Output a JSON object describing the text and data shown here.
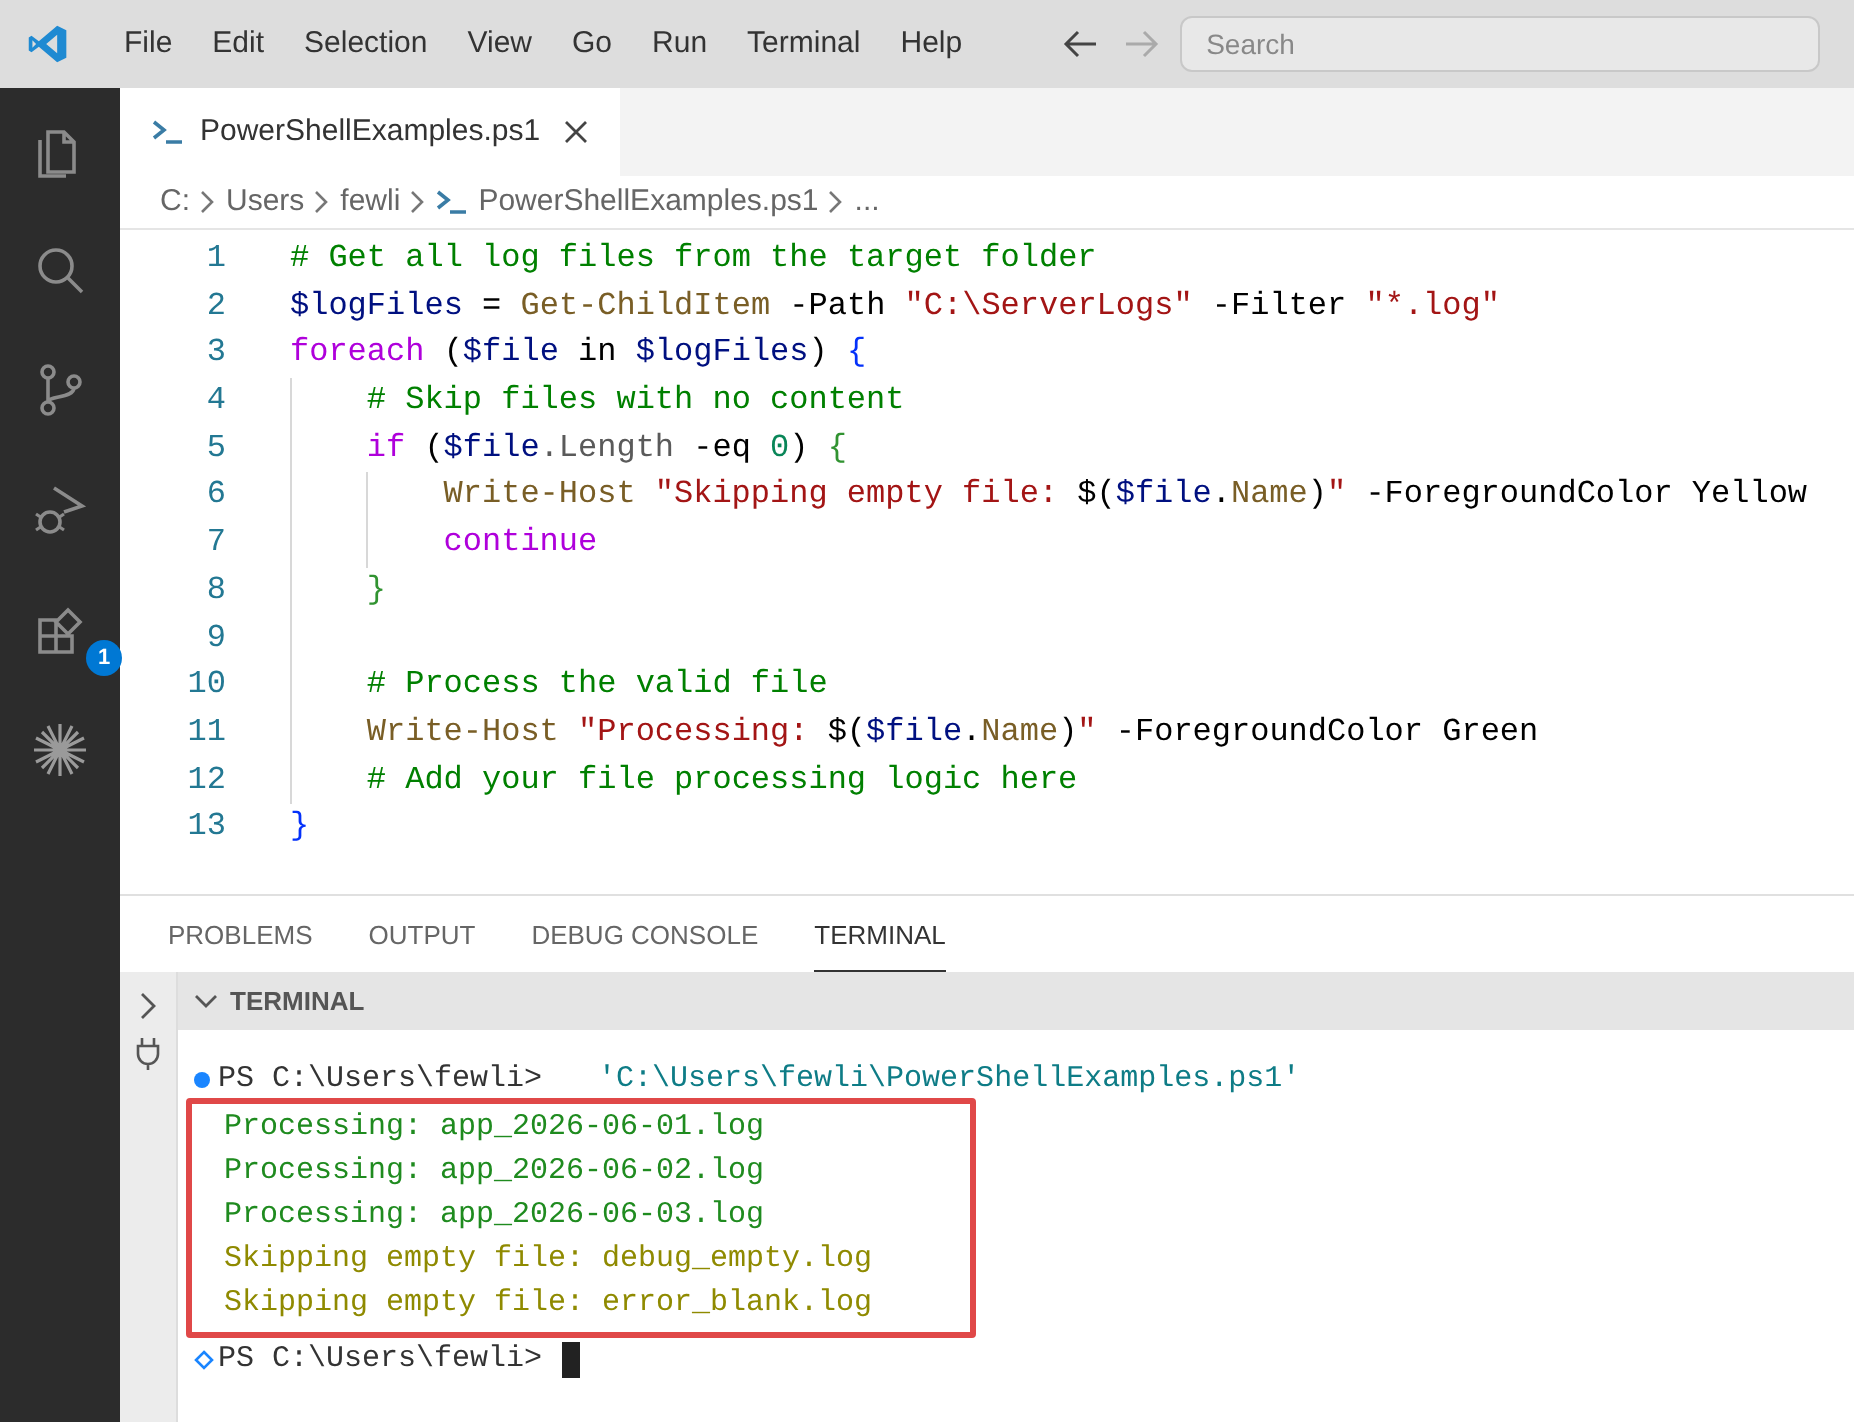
{
  "menu_bar": {
    "items": [
      "File",
      "Edit",
      "Selection",
      "View",
      "Go",
      "Run",
      "Terminal",
      "Help"
    ],
    "search": {
      "placeholder": "Search"
    }
  },
  "activity_bar": {
    "items": [
      {
        "kind": "files",
        "selected": false
      },
      {
        "kind": "search",
        "selected": false
      },
      {
        "kind": "source-control",
        "selected": false
      },
      {
        "kind": "run-debug",
        "selected": false
      },
      {
        "kind": "extensions",
        "selected": false,
        "badge": "1"
      },
      {
        "kind": "sparkle",
        "selected": false
      }
    ]
  },
  "tabs": [
    {
      "label": "PowerShellExamples.ps1",
      "selected": true
    }
  ],
  "breadcrumb": [
    {
      "label": "C:",
      "kind": "folder"
    },
    {
      "label": "Users",
      "kind": "folder"
    },
    {
      "label": "fewli",
      "kind": "folder"
    },
    {
      "label": "PowerShellExamples.ps1",
      "kind": "file"
    },
    {
      "label": "...",
      "kind": "folder"
    }
  ],
  "editor": {
    "lines": [
      {
        "number": "1",
        "tokens": [
          {
            "kind": "comment",
            "text": "# Get all log files from the target folder"
          }
        ]
      },
      {
        "number": "2",
        "tokens": [
          {
            "kind": "variable",
            "text": "$logFiles"
          },
          {
            "kind": "plain",
            "text": " = "
          },
          {
            "kind": "command",
            "text": "Get-ChildItem"
          },
          {
            "kind": "plain",
            "text": " -Path "
          },
          {
            "kind": "string",
            "text": "\"C:\\ServerLogs\""
          },
          {
            "kind": "plain",
            "text": " -Filter "
          },
          {
            "kind": "string",
            "text": "\"*.log\""
          }
        ]
      },
      {
        "number": "3",
        "tokens": [
          {
            "kind": "keyword",
            "text": "foreach"
          },
          {
            "kind": "plain",
            "text": " ("
          },
          {
            "kind": "variable",
            "text": "$file"
          },
          {
            "kind": "plain",
            "text": " in "
          },
          {
            "kind": "variable",
            "text": "$logFiles"
          },
          {
            "kind": "plain",
            "text": ") "
          },
          {
            "kind": "brace1",
            "text": "{"
          }
        ],
        "children": [
          {
            "number": "4",
            "tokens": [
              {
                "kind": "comment",
                "text": "# Skip files with no content"
              }
            ]
          },
          {
            "number": "5",
            "tokens": [
              {
                "kind": "keyword",
                "text": "if"
              },
              {
                "kind": "plain",
                "text": " ("
              },
              {
                "kind": "variable",
                "text": "$file"
              },
              {
                "kind": "property",
                "text": ".Length"
              },
              {
                "kind": "plain",
                "text": " -eq "
              },
              {
                "kind": "number",
                "text": "0"
              },
              {
                "kind": "plain",
                "text": ") "
              },
              {
                "kind": "brace2",
                "text": "{"
              }
            ],
            "children": [
              {
                "number": "6",
                "tokens": [
                  {
                    "kind": "command",
                    "text": "Write-Host"
                  },
                  {
                    "kind": "string",
                    "text": " \"Skipping empty file: "
                  },
                  {
                    "kind": "plain",
                    "text": "$("
                  },
                  {
                    "kind": "variable",
                    "text": "$file"
                  },
                  {
                    "kind": "plain",
                    "text": "."
                  },
                  {
                    "kind": "command",
                    "text": "Name"
                  },
                  {
                    "kind": "plain",
                    "text": ")"
                  },
                  {
                    "kind": "string",
                    "text": "\""
                  },
                  {
                    "kind": "plain",
                    "text": " -ForegroundColor Yellow"
                  }
                ]
              },
              {
                "number": "7",
                "tokens": [
                  {
                    "kind": "keyword",
                    "text": "continue"
                  }
                ]
              }
            ]
          },
          {
            "number": "8",
            "tokens": [
              {
                "kind": "brace2",
                "text": "}"
              }
            ]
          },
          {
            "number": "9"
          },
          {
            "number": "10",
            "tokens": [
              {
                "kind": "comment",
                "text": "# Process the valid file"
              }
            ]
          },
          {
            "number": "11",
            "tokens": [
              {
                "kind": "command",
                "text": "Write-Host"
              },
              {
                "kind": "string",
                "text": " \"Processing: "
              },
              {
                "kind": "plain",
                "text": "$("
              },
              {
                "kind": "variable",
                "text": "$file"
              },
              {
                "kind": "plain",
                "text": "."
              },
              {
                "kind": "command",
                "text": "Name"
              },
              {
                "kind": "plain",
                "text": ")"
              },
              {
                "kind": "string",
                "text": "\""
              },
              {
                "kind": "plain",
                "text": " -ForegroundColor Green"
              }
            ]
          },
          {
            "number": "12",
            "tokens": [
              {
                "kind": "comment",
                "text": "# Add your file processing logic here"
              }
            ]
          }
        ]
      },
      {
        "number": "13",
        "tokens": [
          {
            "kind": "brace1",
            "text": "}"
          }
        ]
      }
    ]
  },
  "panel": {
    "tabs": [
      {
        "label": "PROBLEMS",
        "selected": false
      },
      {
        "label": "OUTPUT",
        "selected": false
      },
      {
        "label": "DEBUG CONSOLE",
        "selected": false
      },
      {
        "label": "TERMINAL",
        "selected": true
      }
    ],
    "section_title": "TERMINAL",
    "terminal": {
      "command": {
        "prompt": "PS C:\\Users\\fewli>",
        "text": "'C:\\Users\\fewli\\PowerShellExamples.ps1'"
      },
      "output": [
        {
          "kind": "success",
          "text": "Processing: app_2026-06-01.log"
        },
        {
          "kind": "success",
          "text": "Processing: app_2026-06-02.log"
        },
        {
          "kind": "success",
          "text": "Processing: app_2026-06-03.log"
        },
        {
          "kind": "warning",
          "text": "Skipping empty file: debug_empty.log"
        },
        {
          "kind": "warning",
          "text": "Skipping empty file: error_blank.log"
        }
      ],
      "output_highlighted": true,
      "prompt": "PS C:\\Users\\fewli>"
    }
  }
}
